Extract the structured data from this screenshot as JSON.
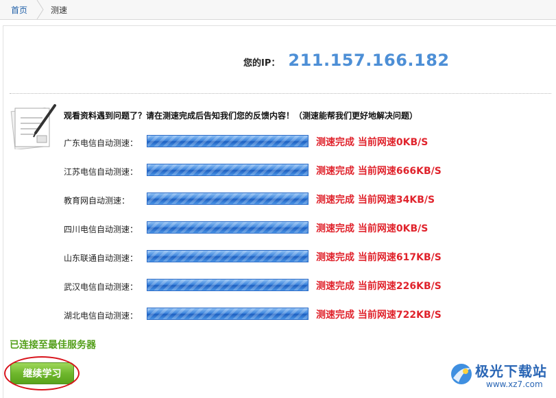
{
  "breadcrumb": {
    "home": "首页",
    "current": "测速"
  },
  "ip": {
    "label": "您的IP：",
    "value": "211.157.166.182"
  },
  "notice": "观看资料遇到问题了？请在测速完成后告知我们您的反馈内容！（测速能帮我们更好地解决问题）",
  "tests": [
    {
      "label": "广东电信自动测速：",
      "result": "测速完成 当前网速0KB/S"
    },
    {
      "label": "江苏电信自动测速：",
      "result": "测速完成 当前网速666KB/S"
    },
    {
      "label": "教育网自动测速：",
      "result": "测速完成 当前网速34KB/S"
    },
    {
      "label": "四川电信自动测速：",
      "result": "测速完成 当前网速0KB/S"
    },
    {
      "label": "山东联通自动测速：",
      "result": "测速完成 当前网速617KB/S"
    },
    {
      "label": "武汉电信自动测速：",
      "result": "测速完成 当前网速226KB/S"
    },
    {
      "label": "湖北电信自动测速：",
      "result": "测速完成 当前网速722KB/S"
    }
  ],
  "status": "已连接至最佳服务器",
  "continue_label": "继续学习",
  "watermark": {
    "name": "极光下载站",
    "url": "www.xz7.com"
  },
  "colors": {
    "ip_value": "#4d8fd6",
    "result_text": "#e0232c",
    "status_text": "#55a01c",
    "button": "#6fb82d",
    "highlight_oval": "#d8131b"
  }
}
